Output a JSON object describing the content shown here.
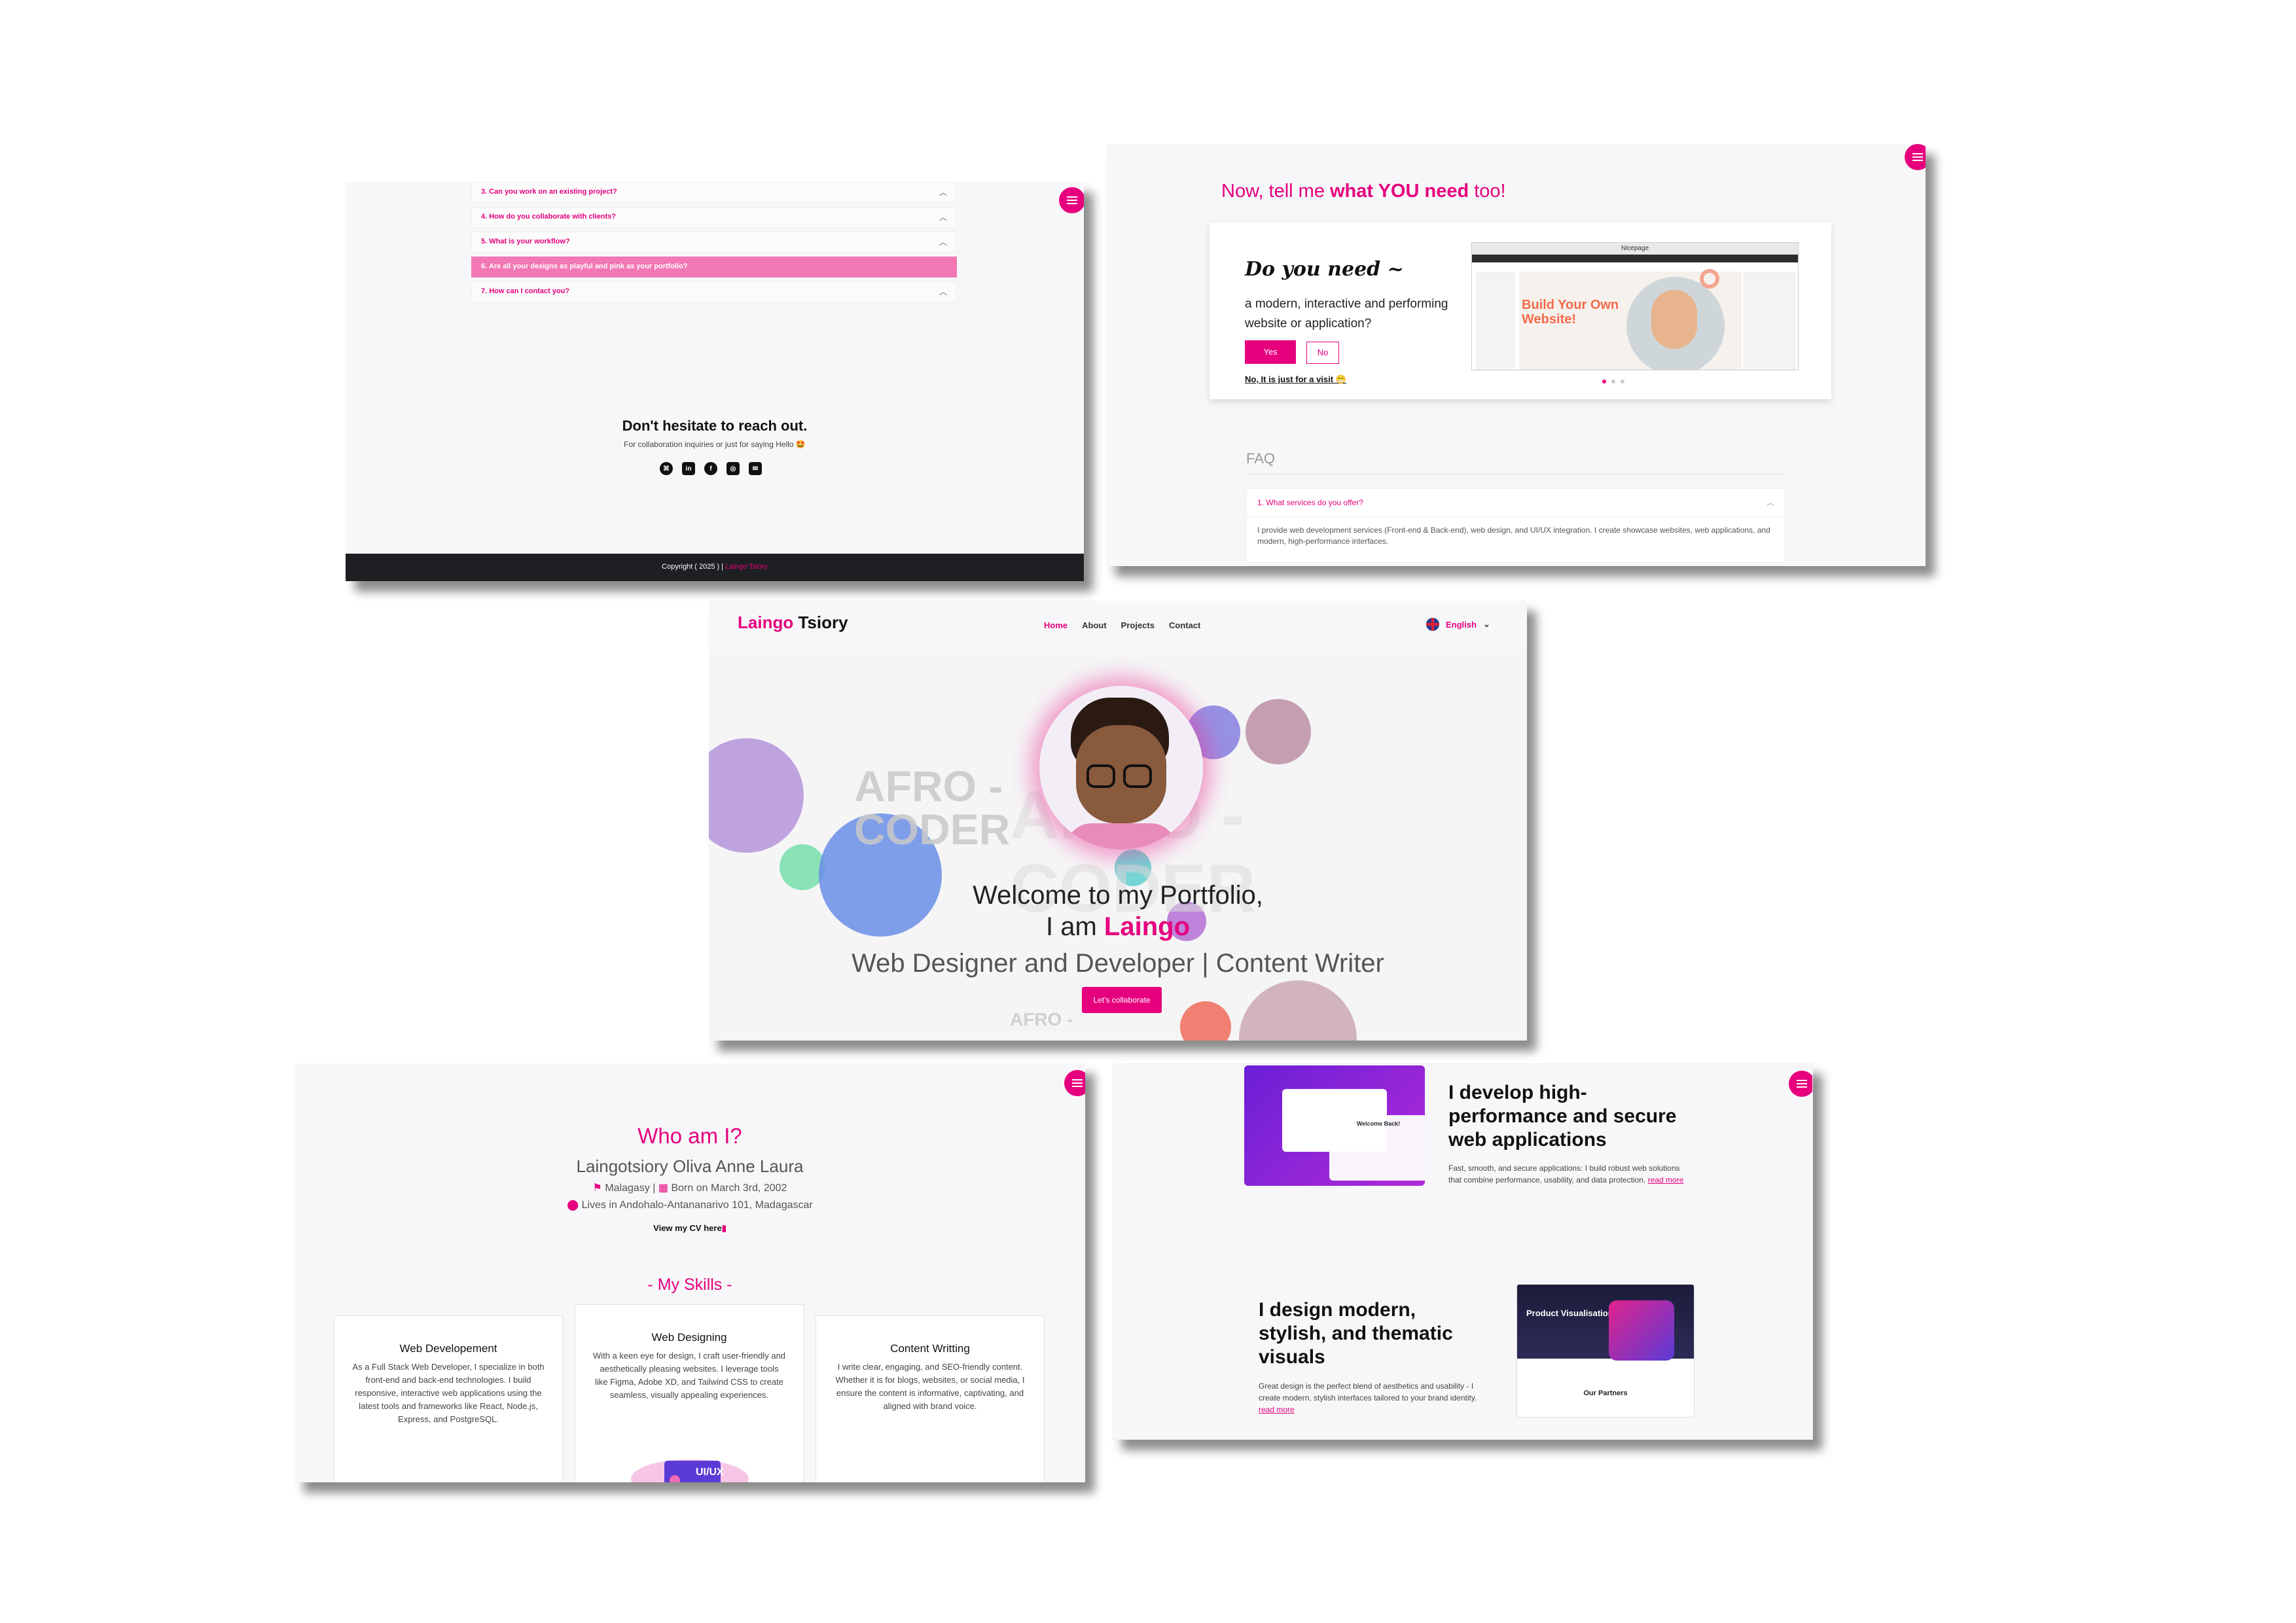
{
  "faq_panel": {
    "items": [
      {
        "q": "3. Can you work on an existing project?",
        "active": false
      },
      {
        "q": "4. How do you collaborate with clients?",
        "active": false
      },
      {
        "q": "5. What is your workflow?",
        "active": false
      },
      {
        "q": "6. Are all your designs as playful and pink as your portfolio?",
        "active": true
      },
      {
        "q": "7. How can I contact you?",
        "active": false
      }
    ],
    "contact_title": "Don't hesitate to reach out.",
    "contact_sub": "For collaboration inquiries or just for saying Hello 🤩",
    "socials": [
      "github-icon",
      "linkedin-icon",
      "facebook-icon",
      "instagram-icon",
      "mail-icon"
    ],
    "footer_copy": "Copyright ( 2025 ) |",
    "footer_name": "Laingo Tsiory"
  },
  "need_panel": {
    "title_pre": "Now, tell me ",
    "title_bold": "what YOU need",
    "title_post": " too!",
    "do_you_need": "Do you need ~",
    "desc": "a modern, interactive and performing website or application?",
    "yes": "Yes",
    "no": "No",
    "visit": "No, It is just for a visit 😁",
    "shot_title": "Nicepage",
    "shot_headline": "Build Your Own Website!",
    "faq_heading": "FAQ",
    "faq_q1": "1. What services do you offer?",
    "faq_a1": "I provide web development services (Front-end & Back-end), web design, and UI/UX integration. I create showcase websites, web applications, and modern, high-performance interfaces."
  },
  "hero": {
    "logo_pink": "Laingo",
    "logo_rest": " Tsiory",
    "nav": [
      "Home",
      "About",
      "Projects",
      "Contact"
    ],
    "language": "English",
    "bg_text_1": "AFRO -",
    "bg_text_2": "CODER",
    "bg_text_3": "AFRO -",
    "welcome": "Welcome to my Portfolio,",
    "iam_pre": "I am ",
    "iam_name": "Laingo",
    "role": "Web Designer and Developer | Content Writer",
    "cta": "Let's collaborate"
  },
  "about": {
    "who": "Who am I?",
    "name": "Laingotsiory Oliva Anne Laura",
    "nationality": "Malagasy",
    "born": "Born on March 3rd, 2002",
    "lives": "Lives in Andohalo-Antananarivo 101, Madagascar",
    "cv": "View my CV here",
    "skills_heading": "- My Skills -",
    "skills": [
      {
        "title": "Web Developement",
        "text": "As a Full Stack Web Developer, I specialize in both front-end and back-end technologies. I build responsive, interactive web applications using the latest tools and frameworks like React, Node.js, Express, and PostgreSQL."
      },
      {
        "title": "Web Designing",
        "text": "With a keen eye for design, I craft user-friendly and aesthetically pleasing websites. I leverage tools like Figma, Adobe XD, and Tailwind CSS to create seamless, visually appealing experiences."
      },
      {
        "title": "Content Writting",
        "text": "I write clear, engaging, and SEO-friendly content. Whether it is for blogs, websites, or social media, I ensure the content is informative, captivating, and aligned with brand voice."
      }
    ],
    "uiux_label": "UI/UX"
  },
  "services": {
    "dev_title": "I develop high-performance and secure web applications",
    "dev_text": "Fast, smooth, and secure applications: I build robust web solutions that combine performance, usability, and data protection.",
    "read_more": "read more",
    "design_title": "I design modern, stylish, and thematic visuals",
    "design_text": "Great design is the perfect blend of aesthetics and usability - I create modern, stylish interfaces tailored to your brand identity.",
    "shot1_title": "Welcome Back!",
    "shot2_title": "Product Visualisation",
    "shot2_partners": "Our Partners"
  },
  "colors": {
    "accent": "#e6007e",
    "footer": "#1e1f22",
    "faq_active": "#f277b5"
  }
}
